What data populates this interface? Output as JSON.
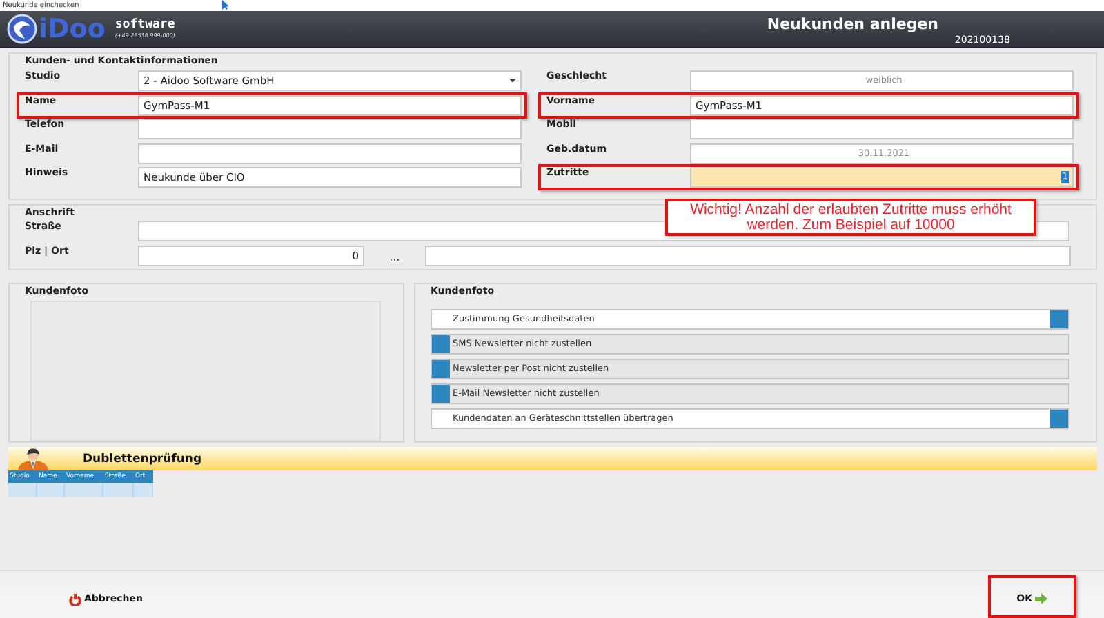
{
  "window": {
    "title": "Neukunde einchecken"
  },
  "header": {
    "brand": "iDoo",
    "brand_suffix": "software",
    "phone": "(+49 28538 999-000)",
    "title": "Neukunden anlegen",
    "number": "202100138"
  },
  "contact": {
    "legend": "Kunden- und Kontaktinformationen",
    "left": [
      {
        "label": "Studio",
        "kind": "select",
        "value": "2 - Aidoo Software GmbH",
        "highlighted": false
      },
      {
        "label": "Name",
        "kind": "text",
        "value": "GymPass-M1",
        "highlighted": true
      },
      {
        "label": "Telefon",
        "kind": "text",
        "highlighted": false
      },
      {
        "label": "E-Mail",
        "kind": "text",
        "highlighted": false
      },
      {
        "label": "Hinweis",
        "kind": "text",
        "value": "Neukunde über CIO",
        "highlighted": false
      }
    ],
    "right": [
      {
        "label": "Geschlecht",
        "kind": "choice",
        "value": "weiblich",
        "highlighted": false
      },
      {
        "label": "Vorname",
        "kind": "text",
        "value": "GymPass-M1",
        "highlighted": true
      },
      {
        "label": "Mobil",
        "kind": "text",
        "highlighted": false
      },
      {
        "label": "Geb.datum",
        "kind": "choice",
        "value": "30.11.2021",
        "highlighted": false
      },
      {
        "label": "Zutritte",
        "kind": "focused",
        "value": "1",
        "highlighted": true
      }
    ]
  },
  "note": {
    "text": "Wichtig! Anzahl der erlaubten Zutritte muss erhöht werden. Zum Beispiel auf 10000"
  },
  "address": {
    "legend": "Anschrift",
    "street_label": "Straße",
    "city_label": "Plz | Ort",
    "zip": "0",
    "lookup": "..."
  },
  "photo": {
    "legend": "Kundenfoto"
  },
  "options": {
    "legend": "Kundenfoto",
    "items": [
      {
        "label": "Zustimmung Gesundheitsdaten",
        "on": true
      },
      {
        "label": "SMS Newsletter nicht zustellen",
        "on": false
      },
      {
        "label": "Newsletter per Post nicht zustellen",
        "on": false
      },
      {
        "label": "E-Mail Newsletter nicht zustellen",
        "on": false
      },
      {
        "label": "Kundendaten an Geräteschnittstellen übertragen",
        "on": true
      }
    ]
  },
  "duplicates": {
    "title": "Dublettenprüfung",
    "columns": [
      "Studio",
      "Name",
      "Vorname",
      "Straße",
      "Ort"
    ]
  },
  "footer": {
    "cancel": {
      "label": "Abbrechen",
      "highlighted": false
    },
    "ok": {
      "label": "OK",
      "highlighted": true
    }
  }
}
